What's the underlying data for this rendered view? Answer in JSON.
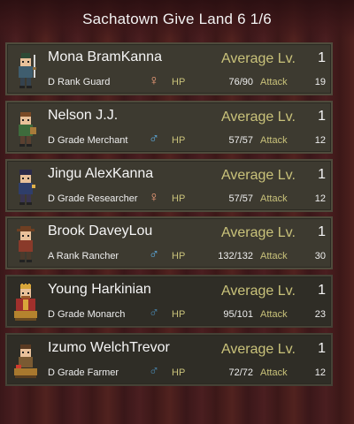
{
  "header": {
    "title": "Sachatown Give Land 6 1/6"
  },
  "colors": {
    "accent_gold": "#c9c27a",
    "female": "#f2a07c",
    "male": "#5fb0e6"
  },
  "labels": {
    "avg": "Average Lv.",
    "hp": "HP",
    "attack": "Attack"
  },
  "residents": [
    {
      "name": "Mona BramKanna",
      "level": "1",
      "rank": "D Rank Guard",
      "gender": "♀",
      "gender_type": "female",
      "hp": "76/90",
      "attack": "19",
      "portrait": "guard-portrait-icon"
    },
    {
      "name": "Nelson J.J.",
      "level": "1",
      "rank": "D Grade Merchant",
      "gender": "♂",
      "gender_type": "male",
      "hp": "57/57",
      "attack": "12",
      "portrait": "merchant-portrait-icon"
    },
    {
      "name": "Jingu AlexKanna",
      "level": "1",
      "rank": "D Grade Researcher",
      "gender": "♀",
      "gender_type": "female",
      "hp": "57/57",
      "attack": "12",
      "portrait": "researcher-portrait-icon"
    },
    {
      "name": "Brook DaveyLou",
      "level": "1",
      "rank": "A Rank Rancher",
      "gender": "♂",
      "gender_type": "male",
      "hp": "132/132",
      "attack": "30",
      "portrait": "rancher-portrait-icon"
    },
    {
      "name": "Young Harkinian",
      "level": "1",
      "rank": "D Grade Monarch",
      "gender": "♂",
      "gender_type": "male",
      "hp": "95/101",
      "attack": "23",
      "portrait": "monarch-portrait-icon"
    },
    {
      "name": "Izumo WelchTrevor",
      "level": "1",
      "rank": "D Grade Farmer",
      "gender": "♂",
      "gender_type": "male",
      "hp": "72/72",
      "attack": "12",
      "portrait": "farmer-portrait-icon"
    }
  ]
}
